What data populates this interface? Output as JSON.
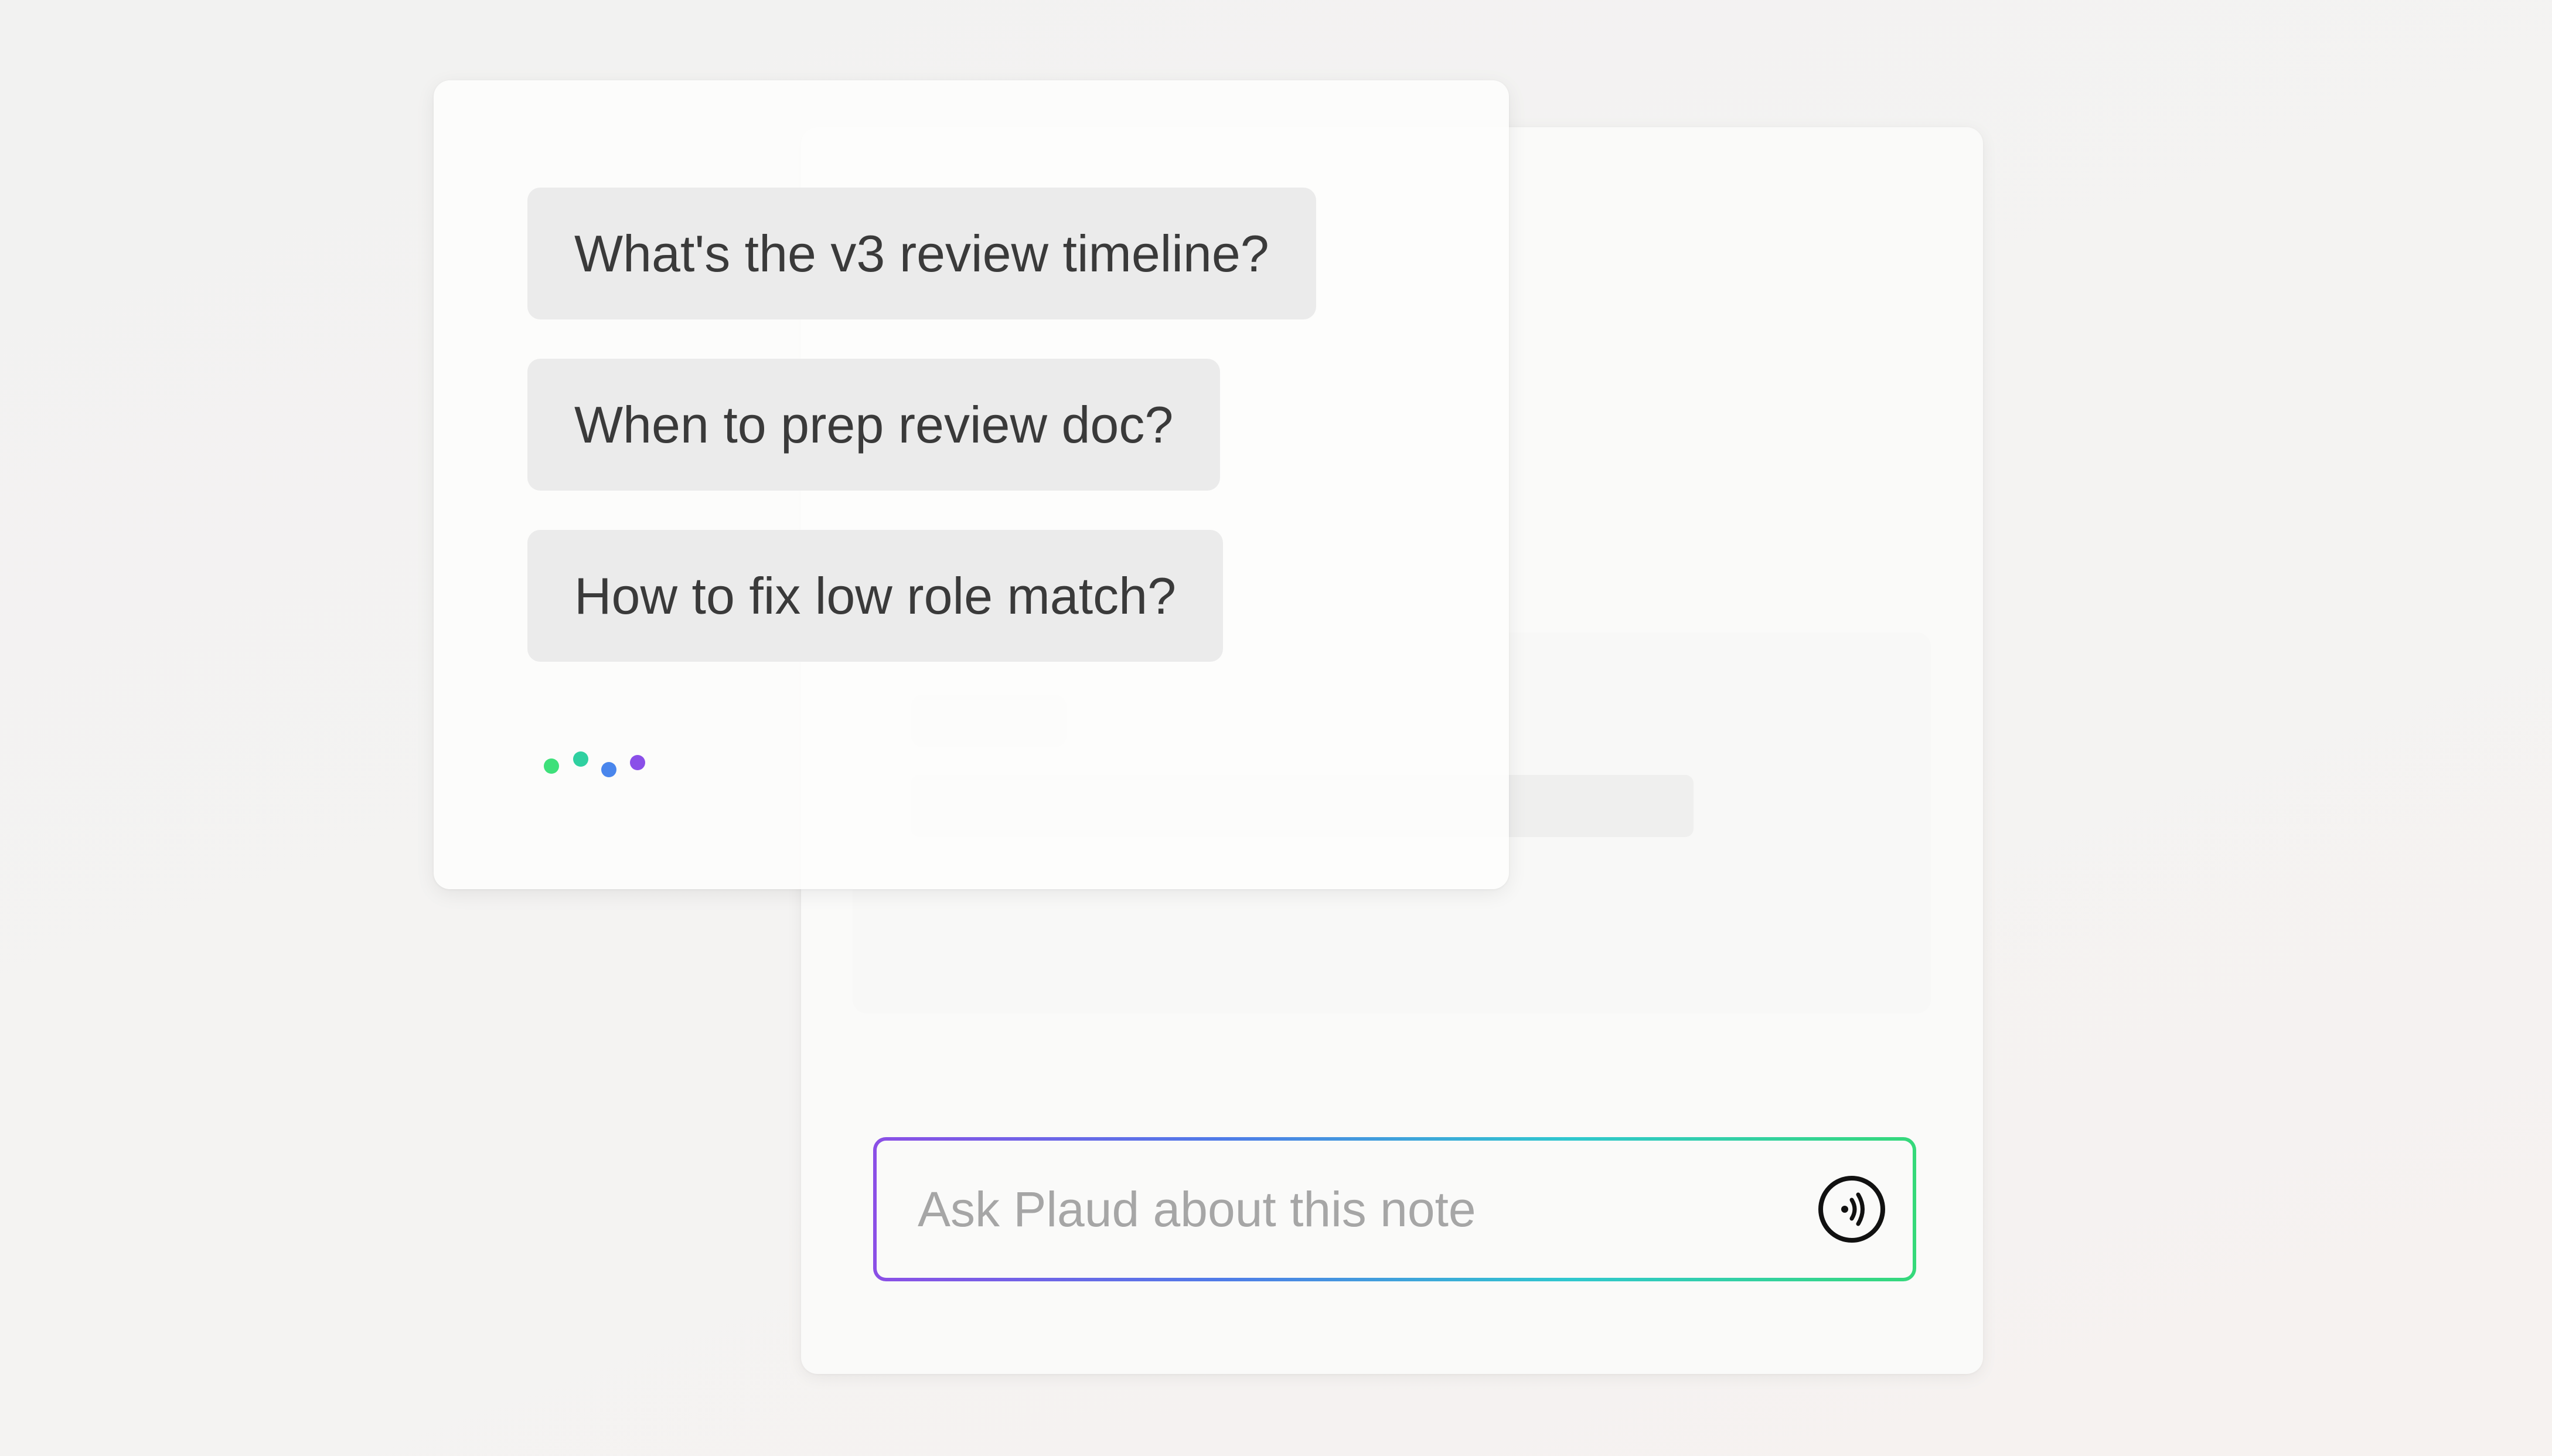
{
  "suggestions": [
    {
      "label": "What's the v3 review timeline?"
    },
    {
      "label": "When to prep review doc?"
    },
    {
      "label": "How to fix low role match?"
    }
  ],
  "typing_indicator": {
    "colors": [
      "#3ee07a",
      "#2fd0a0",
      "#4a86ec",
      "#8a4fe8"
    ]
  },
  "ask": {
    "placeholder": "Ask Plaud about this note",
    "value": "",
    "button_icon": "voice-wave-icon",
    "border_gradient": [
      "#8b4fe6",
      "#4f7be8",
      "#2fc7cf",
      "#35d97a"
    ]
  }
}
